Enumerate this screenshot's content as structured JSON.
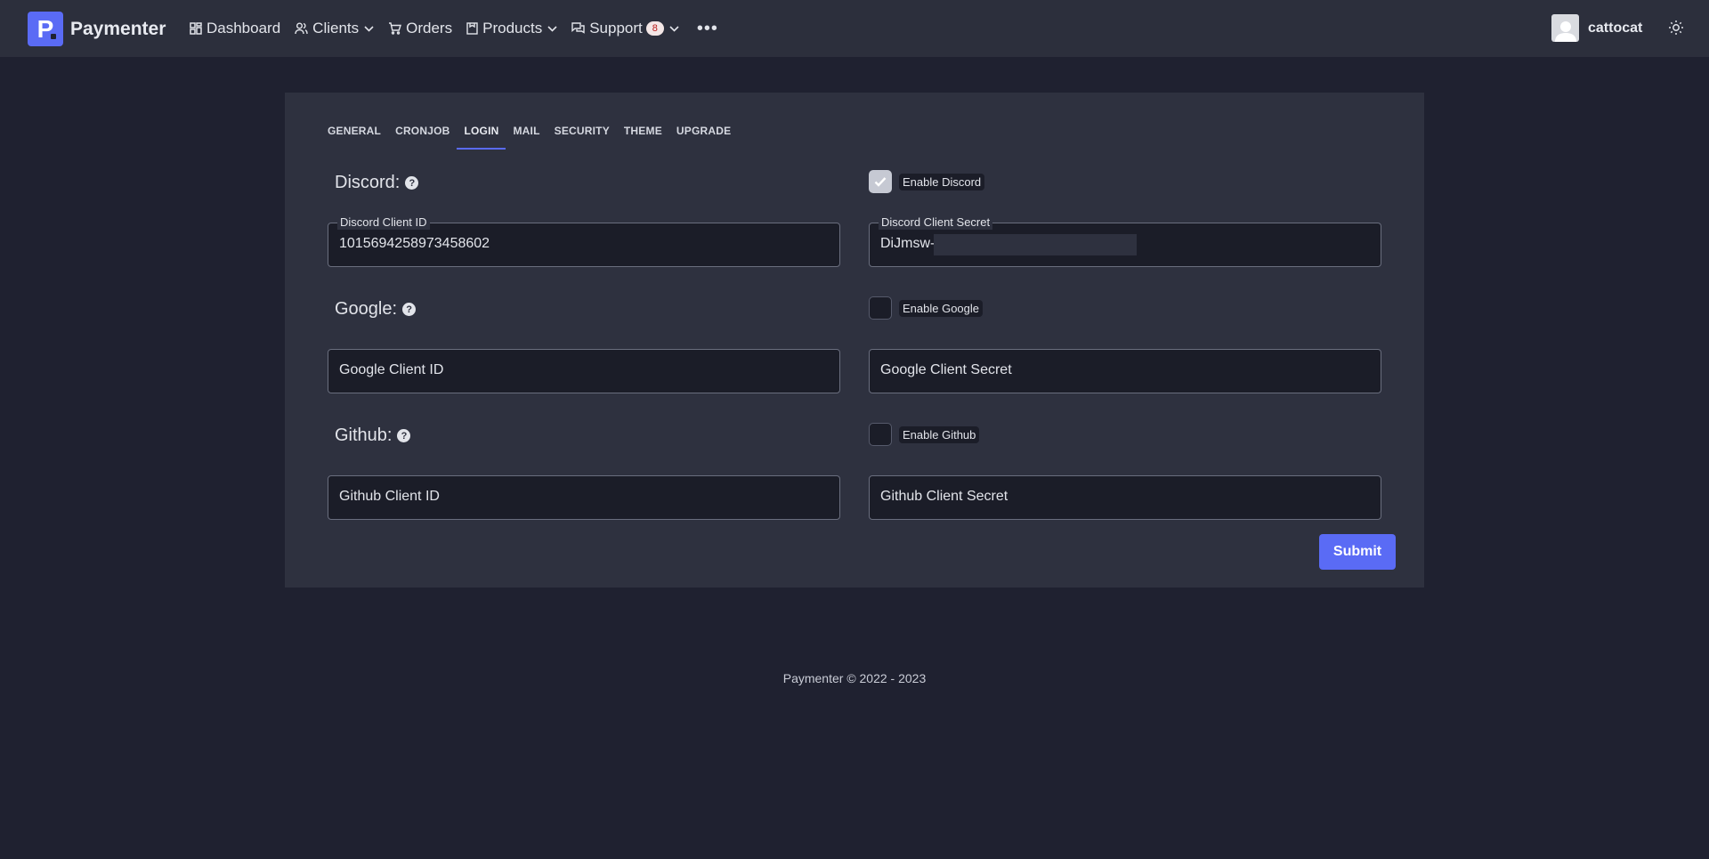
{
  "brand": {
    "name": "Paymenter",
    "logo_letter": "P"
  },
  "nav": {
    "items": [
      {
        "label": "Dashboard",
        "icon": "dashboard-icon",
        "dropdown": false
      },
      {
        "label": "Clients",
        "icon": "users-icon",
        "dropdown": true
      },
      {
        "label": "Orders",
        "icon": "cart-icon",
        "dropdown": false
      },
      {
        "label": "Products",
        "icon": "box-icon",
        "dropdown": true
      },
      {
        "label": "Support",
        "icon": "chat-icon",
        "dropdown": true,
        "badge": "8"
      }
    ],
    "more": "•••"
  },
  "user": {
    "name": "cattocat"
  },
  "tabs": [
    {
      "label": "GENERAL",
      "active": false
    },
    {
      "label": "CRONJOB",
      "active": false
    },
    {
      "label": "LOGIN",
      "active": true
    },
    {
      "label": "MAIL",
      "active": false
    },
    {
      "label": "SECURITY",
      "active": false
    },
    {
      "label": "THEME",
      "active": false
    },
    {
      "label": "UPGRADE",
      "active": false
    }
  ],
  "discord": {
    "title": "Discord:",
    "enable_label": "Enable Discord",
    "enabled": true,
    "client_id_label": "Discord Client ID",
    "client_id_value": "1015694258973458602",
    "client_secret_label": "Discord Client Secret",
    "client_secret_value": "DiJmsw-"
  },
  "google": {
    "title": "Google:",
    "enable_label": "Enable Google",
    "enabled": false,
    "client_id_placeholder": "Google Client ID",
    "client_secret_placeholder": "Google Client Secret"
  },
  "github": {
    "title": "Github:",
    "enable_label": "Enable Github",
    "enabled": false,
    "client_id_placeholder": "Github Client ID",
    "client_secret_placeholder": "Github Client Secret"
  },
  "submit_label": "Submit",
  "footer": "Paymenter © 2022 - 2023",
  "colors": {
    "accent": "#5a6bf5",
    "badge_text": "#b91c1c"
  }
}
